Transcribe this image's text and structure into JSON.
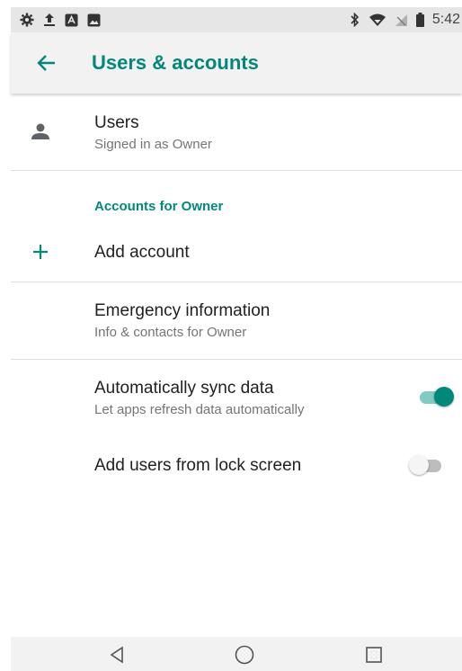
{
  "status_bar": {
    "left_icons": [
      "gear-icon",
      "upload-icon",
      "app-a-icon",
      "image-icon"
    ],
    "right_icons": [
      "bluetooth-icon",
      "wifi-icon",
      "no-signal-icon",
      "battery-icon"
    ],
    "time": "5:42"
  },
  "app_bar": {
    "title": "Users & accounts",
    "back_icon": "arrow-back-icon"
  },
  "items": {
    "users": {
      "title": "Users",
      "subtitle": "Signed in as Owner",
      "icon": "person-icon"
    },
    "accounts_section": {
      "label": "Accounts for Owner"
    },
    "add_account": {
      "title": "Add account",
      "icon": "plus-icon"
    },
    "emergency": {
      "title": "Emergency information",
      "subtitle": "Info & contacts for Owner"
    },
    "auto_sync": {
      "title": "Automatically sync data",
      "subtitle": "Let apps refresh data automatically",
      "enabled": true
    },
    "lock_screen": {
      "title": "Add users from lock screen",
      "enabled": false
    }
  },
  "nav_bar": {
    "back": "triangle-back-icon",
    "home": "circle-home-icon",
    "recents": "square-recents-icon"
  },
  "colors": {
    "accent": "#00897b",
    "toggle_on_track": "#80cbc4",
    "toggle_off_thumb": "#f5f5f5",
    "toggle_off_track": "#bdbdbd"
  }
}
